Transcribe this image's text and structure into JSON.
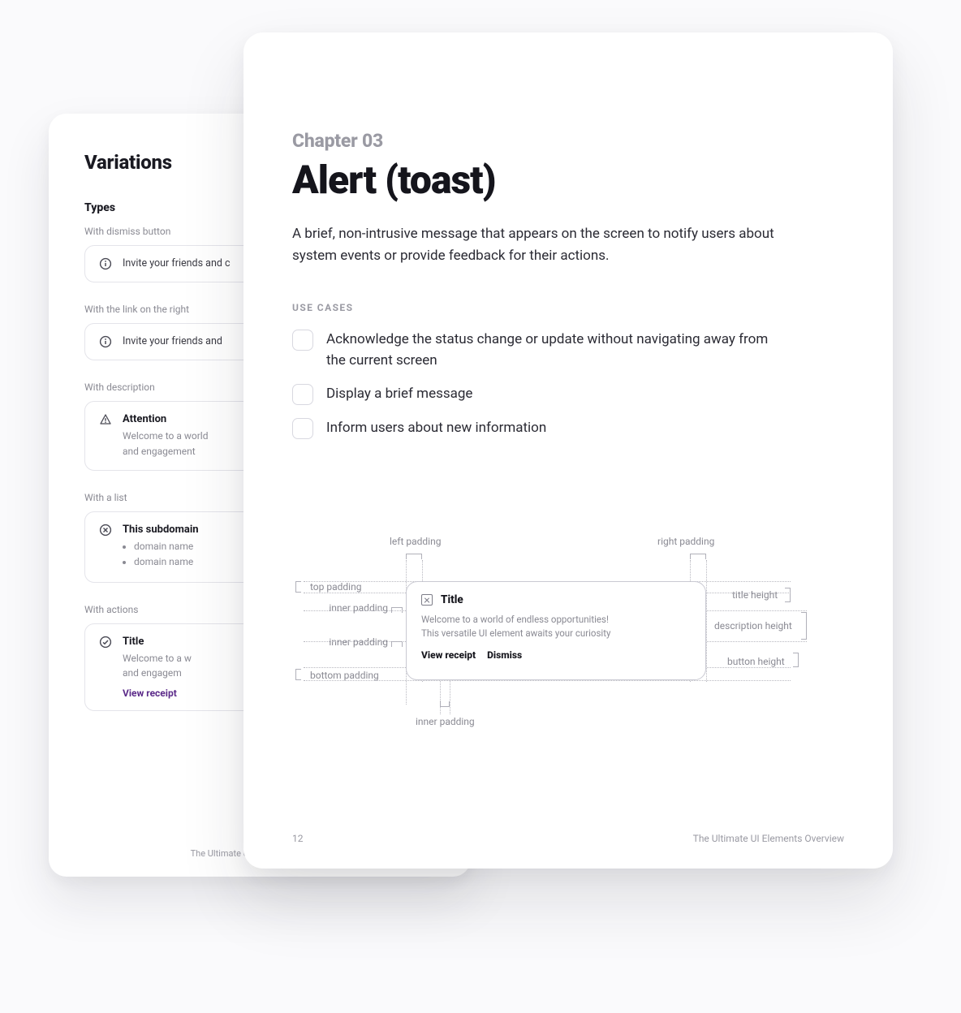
{
  "back": {
    "title": "Variations",
    "subsection": "Types",
    "items": [
      {
        "label": "With dismiss button",
        "kind": "single",
        "icon": "info",
        "text": "Invite your friends and c"
      },
      {
        "label": "With the link on the right",
        "kind": "single",
        "icon": "info",
        "text": "Invite your friends and"
      },
      {
        "label": "With description",
        "kind": "desc",
        "icon": "warn",
        "title": "Attention",
        "desc_lines": [
          "Welcome to a world",
          "and engagement"
        ]
      },
      {
        "label": "With a list",
        "kind": "list",
        "icon": "error",
        "title": "This subdomain",
        "list": [
          "domain name",
          "domain name"
        ]
      },
      {
        "label": "With actions",
        "kind": "actions",
        "icon": "check",
        "title": "Title",
        "desc_lines": [
          "Welcome to a w",
          "and engagem"
        ],
        "action": "View receipt"
      }
    ],
    "footer": "The Ultimate UI Elements Overview"
  },
  "front": {
    "eyebrow": "Chapter 03",
    "title": "Alert (toast)",
    "lead": "A brief, non-intrusive message that appears on the screen to notify users about system events or provide feedback for their actions.",
    "use_cases_label": "USE CASES",
    "use_cases": [
      "Acknowledge the status change or update without navigating away from the current screen",
      "Display a brief message",
      "Inform users about new information"
    ],
    "diagram": {
      "left_labels": {
        "top_padding": "top padding",
        "inner_padding": "inner padding",
        "bottom_padding": "bottom padding",
        "left_padding": "left padding"
      },
      "right_labels": {
        "right_padding": "right padding",
        "title_height": "title height",
        "description_height": "description height",
        "button_height": "button height"
      },
      "bottom_label": "inner padding",
      "card": {
        "title": "Title",
        "desc1": "Welcome to a world of endless opportunities!",
        "desc2": "This versatile UI element awaits your curiosity",
        "action1": "View receipt",
        "action2": "Dismiss"
      }
    },
    "footer": {
      "page": "12",
      "book": "The Ultimate UI Elements Overview"
    }
  }
}
